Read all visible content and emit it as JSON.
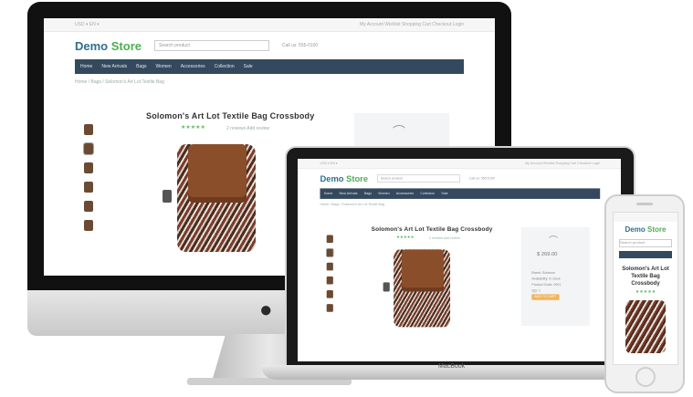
{
  "site": {
    "logo_text": "Demo",
    "logo_accent": "Store",
    "topbar_left": "USD ▾   EN ▾",
    "topbar_right": "My Account   Wishlist   Shopping Cart   Checkout   Login",
    "search_placeholder": "Search product",
    "contact": "Call us: 555-0100",
    "nav_items": [
      "Home",
      "New Arrivals",
      "Bags",
      "Women",
      "Accessories",
      "Collection",
      "Sale"
    ],
    "breadcrumb": "Home  /  Bags  /  Solomon's Art Lot Textile Bag",
    "product_title": "Solomon's Art Lot Textile Bag Crossbody",
    "stars": "★★★★★",
    "reviews": "2 reviews   Add review",
    "price": "$ 269.00",
    "add_to_cart": "ADD TO CART",
    "info_rows": [
      "Brand: Solomon",
      "Availability: In stock",
      "Product Code: 0001",
      "Qty: 1"
    ]
  },
  "laptop_brand": "MacBook",
  "apple_logo": "",
  "colors": {
    "nav": "#34495e",
    "accent": "#4caf50",
    "brand": "#2f6f8f"
  }
}
